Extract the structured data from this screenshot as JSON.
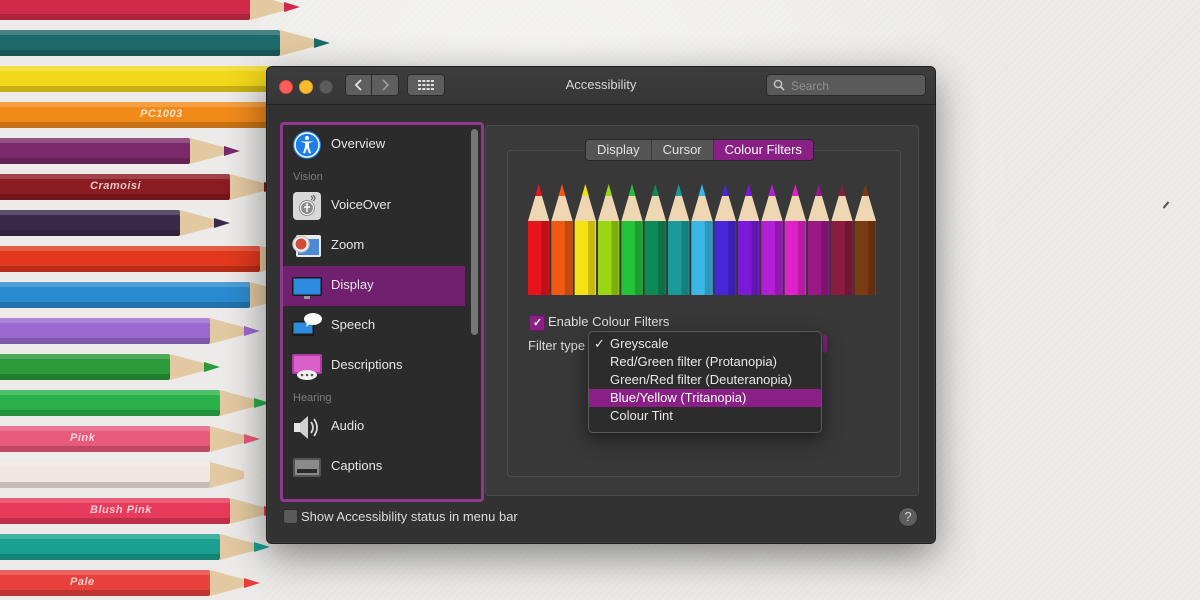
{
  "window": {
    "title": "Accessibility",
    "search_placeholder": "Search"
  },
  "sidebar": {
    "items": [
      {
        "label": "Overview",
        "icon": "accessibility-icon"
      },
      {
        "label": "VoiceOver",
        "icon": "voiceover-icon"
      },
      {
        "label": "Zoom",
        "icon": "zoom-icon"
      },
      {
        "label": "Display",
        "icon": "display-icon",
        "selected": true
      },
      {
        "label": "Speech",
        "icon": "speech-icon"
      },
      {
        "label": "Descriptions",
        "icon": "descriptions-icon"
      },
      {
        "label": "Audio",
        "icon": "audio-icon"
      },
      {
        "label": "Captions",
        "icon": "captions-icon"
      }
    ],
    "sections": {
      "vision": "Vision",
      "hearing": "Hearing"
    }
  },
  "tabs": [
    {
      "label": "Display"
    },
    {
      "label": "Cursor"
    },
    {
      "label": "Colour Filters",
      "active": true
    }
  ],
  "colour_filters": {
    "enable_label": "Enable Colour Filters",
    "enable_checked": true,
    "filter_type_label": "Filter type",
    "options": [
      {
        "label": "Greyscale",
        "checked": true
      },
      {
        "label": "Red/Green filter (Protanopia)"
      },
      {
        "label": "Green/Red filter (Deuteranopia)"
      },
      {
        "label": "Blue/Yellow (Tritanopia)",
        "highlighted": true
      },
      {
        "label": "Colour Tint"
      }
    ],
    "check_glyph": "✓",
    "pencil_colors": [
      "#e8141c",
      "#f05a14",
      "#f4e213",
      "#9bd613",
      "#22c43a",
      "#0e8a54",
      "#1a9a9a",
      "#3ab7e6",
      "#4727d9",
      "#7a1ad6",
      "#b21fd6",
      "#e020c8",
      "#9a1788",
      "#8a1c40",
      "#7a3a12"
    ]
  },
  "bottom": {
    "status_menu_label": "Show Accessibility status in menu bar",
    "status_menu_checked": false,
    "help_glyph": "?"
  },
  "background": {
    "pencils": [
      {
        "color": "#d02a4a"
      },
      {
        "color": "#1e6a6a"
      },
      {
        "color": "#f2d81a",
        "brand": ""
      },
      {
        "color": "#f28a1a",
        "brand": "PC1003"
      },
      {
        "color": "#7a2a6a"
      },
      {
        "color": "#8a1c22",
        "brand": "Cramoisi"
      },
      {
        "color": "#3a2a4a"
      },
      {
        "color": "#e2381e"
      },
      {
        "color": "#2a8ad0"
      },
      {
        "color": "#9a6ad0"
      },
      {
        "color": "#2a9a3a"
      },
      {
        "color": "#2ab04a"
      },
      {
        "color": "#e85a7a",
        "brand": "Pink"
      },
      {
        "color": "#f0e8e0"
      },
      {
        "color": "#e83a5a",
        "brand": "Blush Pink"
      },
      {
        "color": "#1aa090"
      },
      {
        "color": "#e8403a",
        "brand": "Pale"
      }
    ]
  }
}
